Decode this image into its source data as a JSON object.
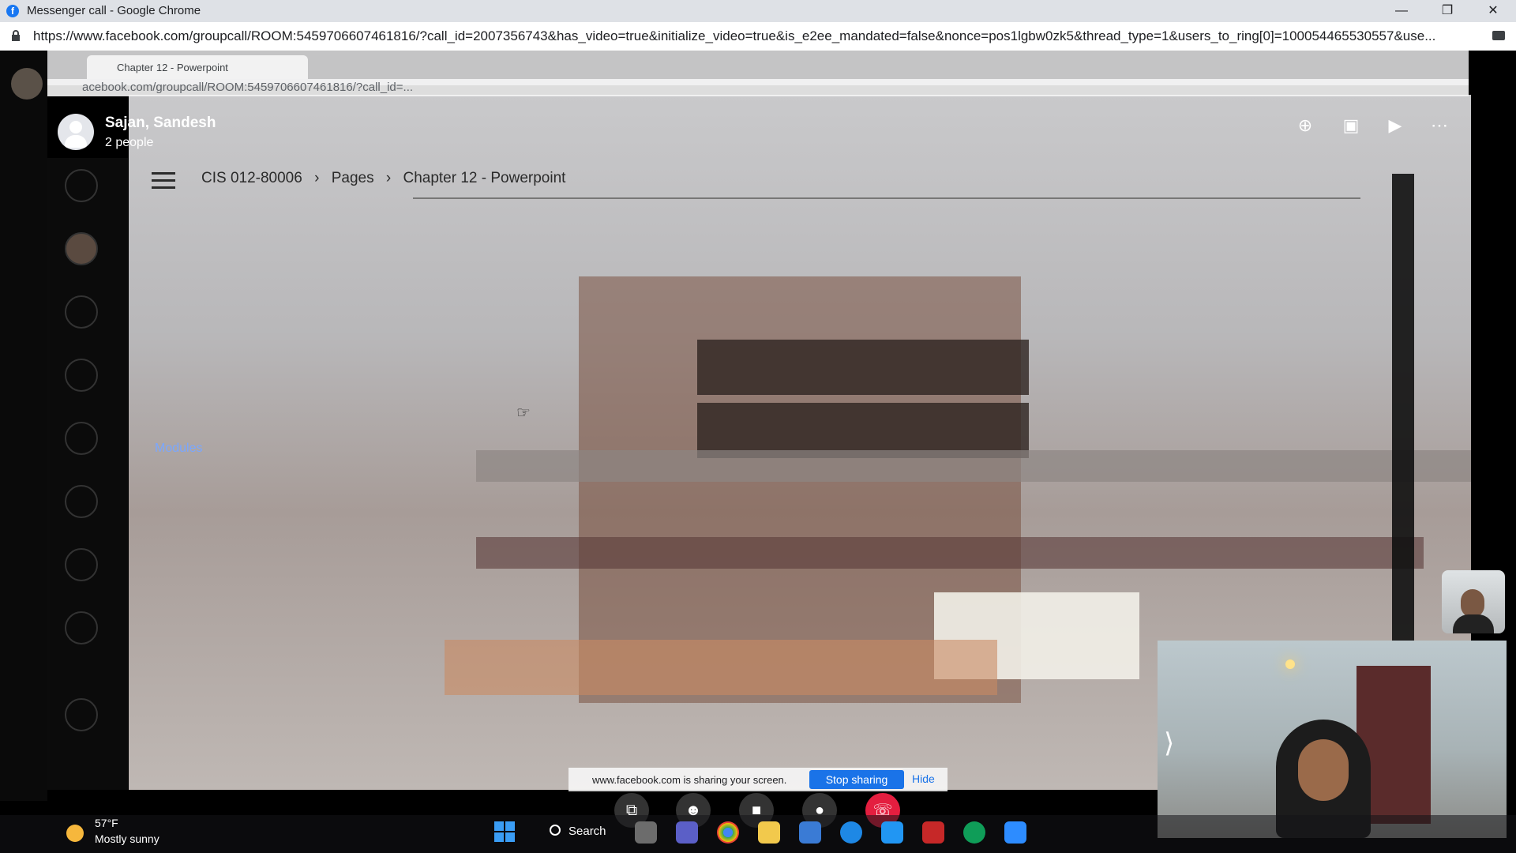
{
  "window": {
    "title": "Messenger call - Google Chrome",
    "favicon_letter": "f",
    "url": "https://www.facebook.com/groupcall/ROOM:5459706607461816/?call_id=2007356743&has_video=true&initialize_video=true&is_e2ee_mandated=false&nonce=pos1lgbw0zk5&thread_type=1&users_to_ring[0]=100054465530557&use..."
  },
  "call": {
    "participant_name": "Sajan, Sandesh",
    "participant_count": "2 people"
  },
  "shared_screen": {
    "inner_tab_title": "Chapter 12 - Powerpoint",
    "inner_url": "acebook.com/groupcall/ROOM:5459706607461816/?call_id=...",
    "breadcrumb": [
      "CIS 012-80006",
      "Pages",
      "Chapter 12 - Powerpoint"
    ],
    "breadcrumb_sep": "›",
    "sidebar_link": "Modules"
  },
  "share_banner": {
    "text": "www.facebook.com is sharing your screen.",
    "stop_label": "Stop sharing",
    "hide_label": "Hide"
  },
  "taskbar": {
    "temperature": "57°F",
    "condition": "Mostly sunny",
    "search_label": "Search",
    "accent": "#3a9df5"
  }
}
